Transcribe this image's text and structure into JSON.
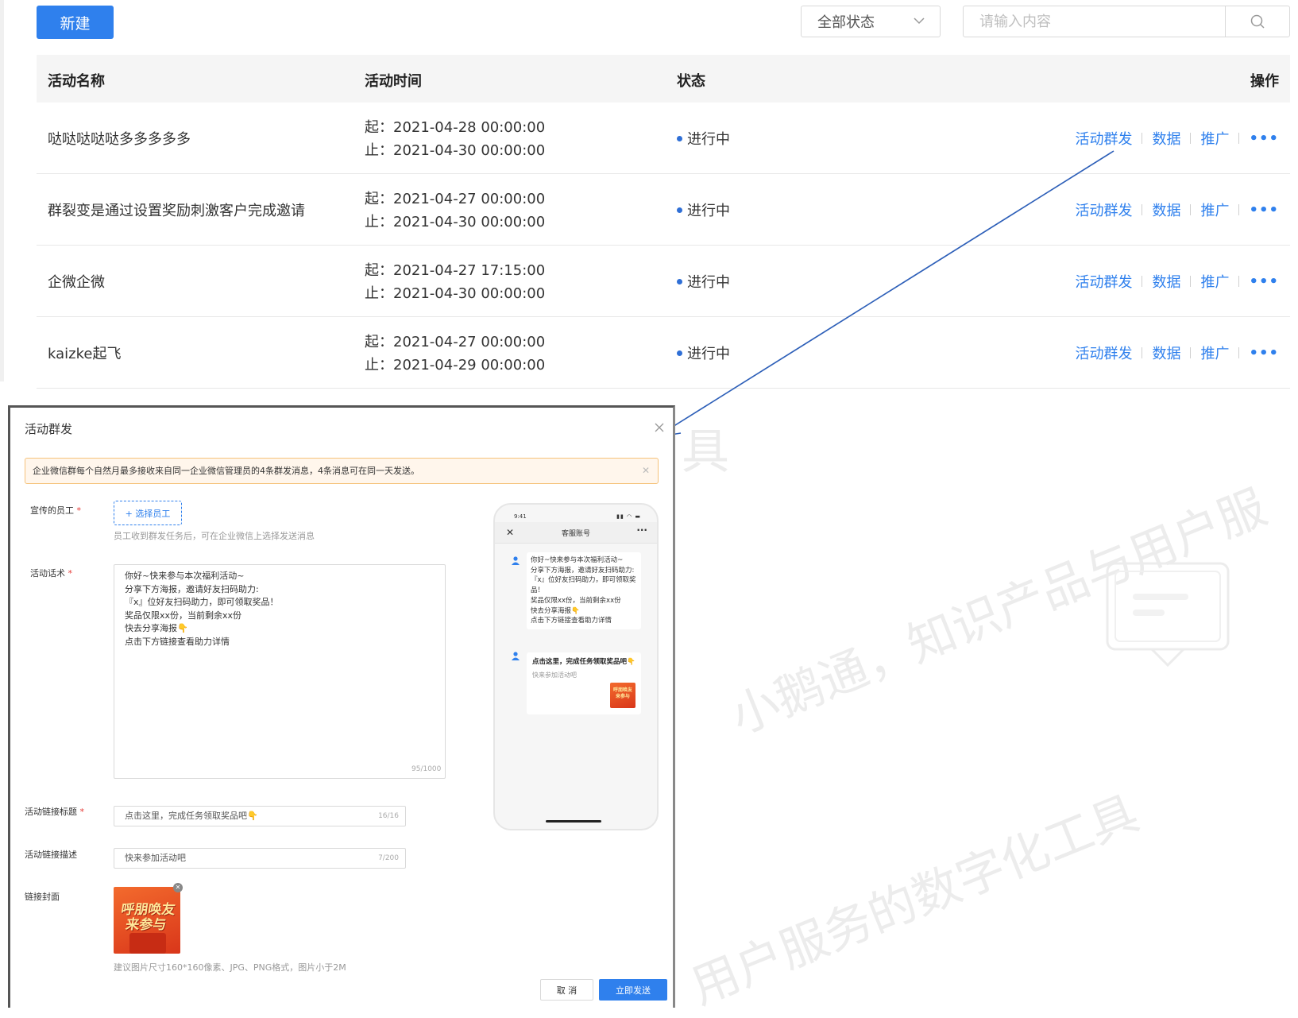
{
  "toolbar": {
    "new_button": "新建",
    "status_filter": "全部状态",
    "search_placeholder": "请输入内容"
  },
  "table": {
    "columns": [
      "活动名称",
      "活动时间",
      "状态",
      "操作"
    ],
    "rows": [
      {
        "name": "哒哒哒哒哒多多多多多",
        "start": "起：2021-04-28 00:00:00",
        "end": "止：2021-04-30 00:00:00",
        "status": "进行中"
      },
      {
        "name": "群裂变是通过设置奖励刺激客户完成邀请",
        "start": "起：2021-04-27 00:00:00",
        "end": "止：2021-04-30 00:00:00",
        "status": "进行中"
      },
      {
        "name": "企微企微",
        "start": "起：2021-04-27 17:15:00",
        "end": "止：2021-04-30 00:00:00",
        "status": "进行中"
      },
      {
        "name": "kaizke起飞",
        "start": "起：2021-04-27 00:00:00",
        "end": "止：2021-04-29 00:00:00",
        "status": "进行中"
      }
    ],
    "actions": [
      "活动群发",
      "数据",
      "推广",
      "•••"
    ]
  },
  "watermark": {
    "line1": "小鹅通，知识产品与用户服",
    "line2": "用户服务的数字化工具",
    "fragment": "具"
  },
  "modal": {
    "title": "活动群发",
    "alert": "企业微信群每个自然月最多接收来自同一企业微信管理员的4条群发消息，4条消息可在同一天发送。",
    "employee_label": "宣传的员工",
    "employee_button": "+ 选择员工",
    "employee_hint": "员工收到群发任务后，可在企业微信上选择发送消息",
    "script_label": "活动话术",
    "script_text": "你好~快来参与本次福利活动~\n分享下方海报，邀请好友扫码助力:\n『x』位好友扫码助力，即可领取奖品！\n奖品仅限xx份，当前剩余xx份\n快去分享海报👇\n点击下方链接查看助力详情",
    "script_counter": "95/1000",
    "link_title_label": "活动链接标题",
    "link_title_value": "点击这里，完成任务领取奖品吧👇",
    "link_title_counter": "16/16",
    "link_desc_label": "活动链接描述",
    "link_desc_value": "快来参加活动吧",
    "link_desc_counter": "7/200",
    "cover_label": "链接封面",
    "cover_text": "呼朋唤友 来参与",
    "cover_hint": "建议图片尺寸160*160像素、JPG、PNG格式，图片小于2M",
    "cancel": "取 消",
    "send": "立即发送"
  },
  "phone": {
    "time": "9:41",
    "title": "客服账号",
    "message": "你好~快来参与本次福利活动~\n分享下方海报，邀请好友扫码助力:\n『x』位好友扫码助力，即可领取奖品！\n奖品仅限xx份，当前剩余xx份\n快去分享海报👇\n点击下方链接查看助力详情",
    "card_title": "点击这里，完成任务领取奖品吧👇",
    "card_desc": "快来参加活动吧",
    "card_thumb_text": "呼朋唤友 来参与"
  },
  "colors": {
    "primary": "#2f80ed",
    "status_dot": "#2f6fd6",
    "alert_bg": "#fff6ec",
    "cover": "#e2471f"
  }
}
